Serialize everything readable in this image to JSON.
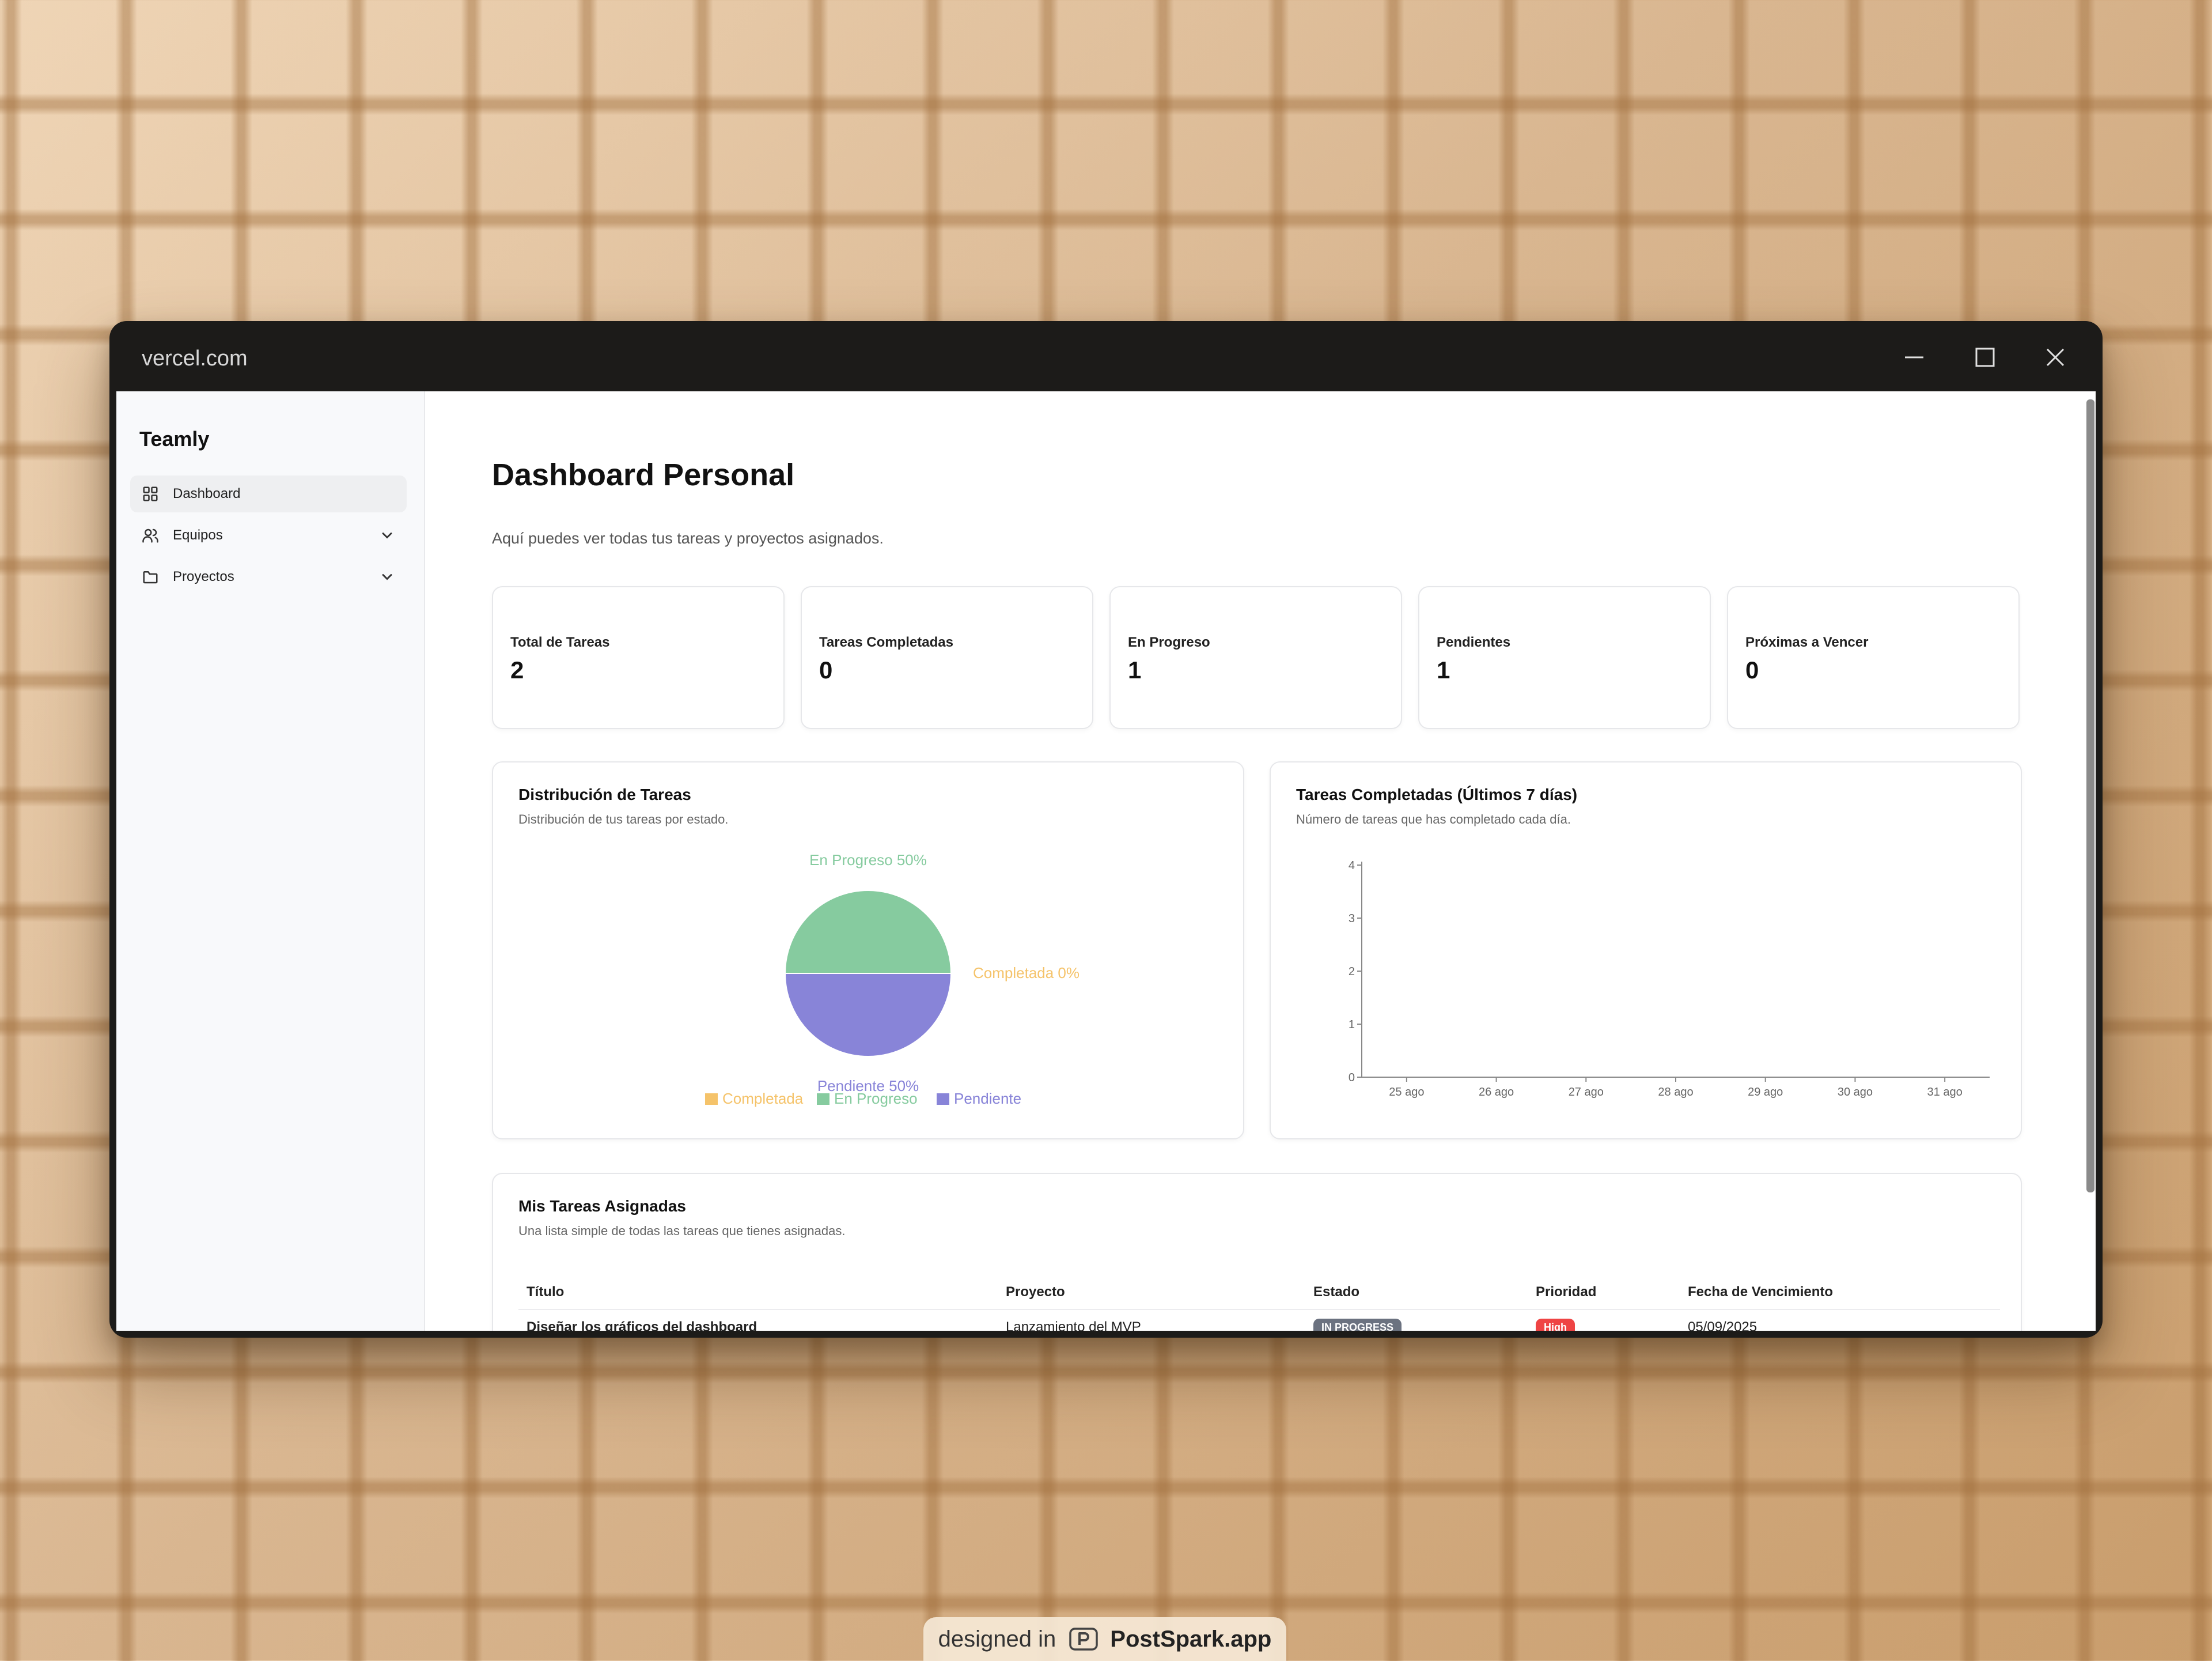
{
  "window": {
    "url": "vercel.com"
  },
  "sidebar": {
    "brand": "Teamly",
    "items": [
      {
        "label": "Dashboard",
        "icon": "grid-icon",
        "active": true,
        "expandable": false
      },
      {
        "label": "Equipos",
        "icon": "users-icon",
        "active": false,
        "expandable": true
      },
      {
        "label": "Proyectos",
        "icon": "folder-icon",
        "active": false,
        "expandable": true
      }
    ]
  },
  "header": {
    "title": "Dashboard Personal",
    "subtitle": "Aquí puedes ver todas tus tareas y proyectos asignados."
  },
  "stats": [
    {
      "label": "Total de Tareas",
      "value": "2"
    },
    {
      "label": "Tareas Completadas",
      "value": "0"
    },
    {
      "label": "En Progreso",
      "value": "1"
    },
    {
      "label": "Pendientes",
      "value": "1"
    },
    {
      "label": "Próximas a Vencer",
      "value": "0"
    }
  ],
  "pie_card": {
    "title": "Distribución de Tareas",
    "description": "Distribución de tus tareas por estado."
  },
  "bar_card": {
    "title": "Tareas Completadas (Últimos 7 días)",
    "description": "Número de tareas que has completado cada día."
  },
  "chart_data": [
    {
      "type": "pie",
      "slices": [
        {
          "name": "Completada",
          "value": 0,
          "label": "Completada 0%",
          "color": "#f5c36a"
        },
        {
          "name": "En Progreso",
          "value": 50,
          "label": "En Progreso 50%",
          "color": "#86cb9f"
        },
        {
          "name": "Pendiente",
          "value": 50,
          "label": "Pendiente 50%",
          "color": "#8884d8"
        }
      ],
      "legend": [
        "Completada",
        "En Progreso",
        "Pendiente"
      ],
      "legend_position": "bottom"
    },
    {
      "type": "bar",
      "categories": [
        "25 ago",
        "26 ago",
        "27 ago",
        "28 ago",
        "29 ago",
        "30 ago",
        "31 ago"
      ],
      "values": [
        0,
        0,
        0,
        0,
        0,
        0,
        0
      ],
      "ylim": [
        0,
        4
      ],
      "yticks": [
        "0",
        "1",
        "2",
        "3",
        "4"
      ]
    }
  ],
  "tasks_card": {
    "title": "Mis Tareas Asignadas",
    "description": "Una lista simple de todas las tareas que tienes asignadas.",
    "columns": [
      "Título",
      "Proyecto",
      "Estado",
      "Prioridad",
      "Fecha de Vencimiento"
    ],
    "rows": [
      {
        "title": "Diseñar los gráficos del dashboard",
        "project": "Lanzamiento del MVP",
        "status": "IN PROGRESS",
        "priority": "High",
        "due": "05/09/2025"
      }
    ]
  },
  "colors": {
    "status_in_progress": "#6b7280",
    "priority_high": "#ef4444",
    "titlebar": "#1c1b19"
  },
  "footer": {
    "prefix": "designed in",
    "brand": "PostSpark.app",
    "icon": "postspark-logo-icon"
  }
}
